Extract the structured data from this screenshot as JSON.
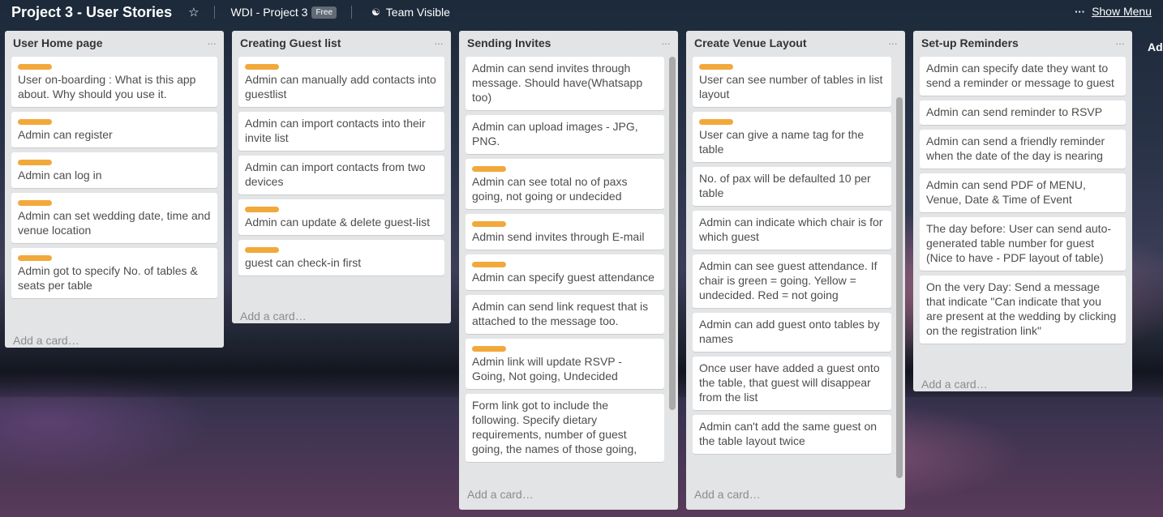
{
  "header": {
    "board_title": "Project 3 - User Stories",
    "star_icon": "star-icon",
    "team_name": "WDI - Project 3",
    "team_badge": "Free",
    "visibility_icon": "people-icon",
    "visibility": "Team Visible",
    "menu_dots": "···",
    "show_menu": "Show Menu"
  },
  "colors": {
    "label": "#f2a93b",
    "list_bg": "#e2e4e6",
    "card_bg": "#ffffff"
  },
  "add_card_label": "Add a card…",
  "add_list_label": "Add a list…",
  "lists": [
    {
      "title": "User Home page",
      "cards": [
        {
          "text": "User on-boarding : What is this app about. Why should you use it.",
          "label": true
        },
        {
          "text": "Admin can register",
          "label": true
        },
        {
          "text": "Admin can log in",
          "label": true
        },
        {
          "text": "Admin can set wedding date, time and venue location",
          "label": true
        },
        {
          "text": "Admin got to specify No. of tables & seats per table",
          "label": true
        }
      ]
    },
    {
      "title": "Creating Guest list",
      "cards": [
        {
          "text": "Admin can manually add contacts into guestlist",
          "label": true
        },
        {
          "text": "Admin can import contacts into their invite list",
          "label": false
        },
        {
          "text": "Admin can import contacts from two devices",
          "label": false
        },
        {
          "text": "Admin can update & delete guest-list",
          "label": true
        },
        {
          "text": "guest can check-in first",
          "label": true
        }
      ]
    },
    {
      "title": "Sending Invites",
      "cards": [
        {
          "text": "Admin can send invites through message. Should have(Whatsapp too)",
          "label": false
        },
        {
          "text": "Admin can upload images - JPG, PNG.",
          "label": false
        },
        {
          "text": "Admin can see total no of paxs going, not going or undecided",
          "label": true
        },
        {
          "text": "Admin send invites through E-mail",
          "label": true
        },
        {
          "text": "Admin can specify guest attendance",
          "label": true
        },
        {
          "text": "Admin can send link request that is attached to the message too.",
          "label": false
        },
        {
          "text": "Admin link will update RSVP - Going, Not going, Undecided",
          "label": true
        },
        {
          "text": "Form link got to include the following. Specify dietary requirements, number of guest going, the names of those going,",
          "label": false
        }
      ]
    },
    {
      "title": "Create Venue Layout",
      "cards": [
        {
          "text": "User can see number of tables in list layout",
          "label": true
        },
        {
          "text": "User can give a name tag for the table",
          "label": true
        },
        {
          "text": "No. of pax will be defaulted 10 per table",
          "label": false
        },
        {
          "text": "Admin can indicate which chair is for which guest",
          "label": false
        },
        {
          "text": "Admin can see guest attendance. If chair is green = going. Yellow = undecided. Red = not going",
          "label": false
        },
        {
          "text": "Admin can add guest onto tables by names",
          "label": false
        },
        {
          "text": "Once user have added a guest onto the table, that guest will disappear from the list",
          "label": false
        },
        {
          "text": "Admin can't add the same guest on the table layout twice",
          "label": false
        }
      ]
    },
    {
      "title": "Set-up Reminders",
      "cards": [
        {
          "text": "Admin can specify date they want to send a reminder or message to guest",
          "label": false
        },
        {
          "text": "Admin can send reminder to RSVP",
          "label": false
        },
        {
          "text": "Admin can send a friendly reminder when the date of the day is nearing",
          "label": false
        },
        {
          "text": "Admin can send PDF of MENU, Venue, Date & Time of Event",
          "label": false
        },
        {
          "text": "The day before: User can send auto-generated table number for guest (Nice to have - PDF layout of table)",
          "label": false
        },
        {
          "text": "On the very Day: Send a message that indicate \"Can indicate that you are present at the wedding by clicking on the registration link\"",
          "label": false
        }
      ]
    }
  ]
}
